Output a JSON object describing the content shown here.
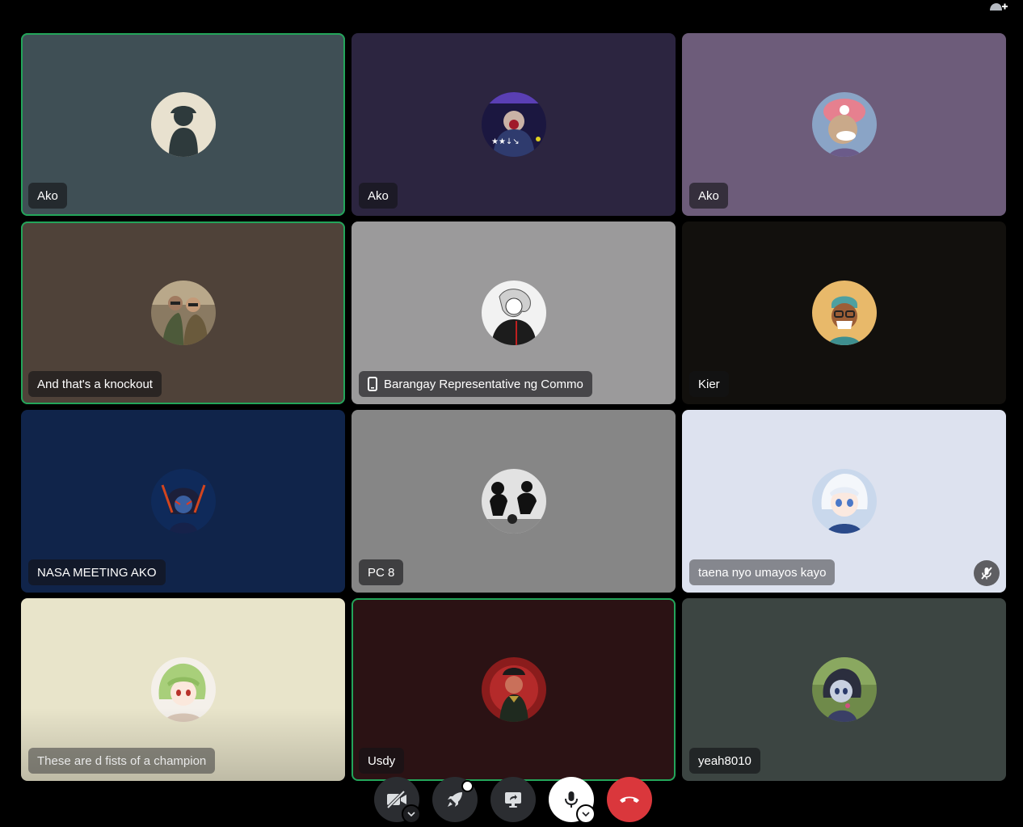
{
  "toolbar": {
    "add_user_icon": "add-user-icon"
  },
  "tiles": [
    {
      "name": "Ako",
      "bg": "#3f4f55",
      "speaking": true,
      "icon": "avatar-silhouette"
    },
    {
      "name": "Ako",
      "bg": "#2c2540",
      "speaking": false,
      "icon": "avatar-dark-character"
    },
    {
      "name": "Ako",
      "bg": "#6d5c7a",
      "speaking": false,
      "icon": "avatar-pink-hat"
    },
    {
      "name": "And that's a knockout",
      "bg": "#4f4239",
      "speaking": true,
      "icon": "avatar-group-photo"
    },
    {
      "name": "Barangay Representative ng Commo",
      "bg": "#9b9a9b",
      "speaking": false,
      "icon": "avatar-sketch",
      "device_icon": "mobile-phone-icon"
    },
    {
      "name": "Kier",
      "bg": "#12100d",
      "speaking": false,
      "icon": "avatar-cartoon-face"
    },
    {
      "name": "NASA MEETING AKO",
      "bg": "#10244a",
      "speaking": false,
      "icon": "avatar-blue-character"
    },
    {
      "name": "PC 8",
      "bg": "#868686",
      "speaking": false,
      "icon": "avatar-black-white"
    },
    {
      "name": "taena nyo umayos kayo",
      "bg": "#dde2ef",
      "speaking": false,
      "icon": "avatar-anime-white-hair",
      "muted": true
    },
    {
      "name": "These are d fists of a champion",
      "bg": "#e8e4ca",
      "speaking": false,
      "icon": "avatar-anime-green-hair"
    },
    {
      "name": "Usdy",
      "bg": "#2b1214",
      "speaking": true,
      "icon": "avatar-red-character"
    },
    {
      "name": "yeah8010",
      "bg": "#3c4542",
      "speaking": false,
      "icon": "avatar-plush-doll"
    }
  ],
  "controls": [
    {
      "name": "camera-off-button",
      "icon": "camera-off-icon"
    },
    {
      "name": "activities-button",
      "icon": "rocket-icon"
    },
    {
      "name": "share-screen-button",
      "icon": "screen-share-icon"
    },
    {
      "name": "microphone-button",
      "icon": "microphone-icon"
    },
    {
      "name": "disconnect-button",
      "icon": "hang-up-icon"
    }
  ],
  "colors": {
    "speaking_ring": "#23a55a",
    "disconnect": "#da373c",
    "background": "#000000"
  }
}
